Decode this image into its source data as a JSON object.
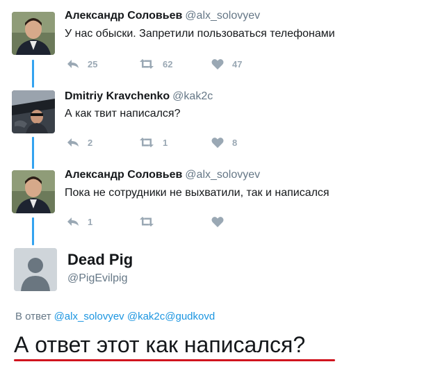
{
  "tweets": [
    {
      "name": "Александр Соловьев",
      "handle": "@alx_solovyev",
      "text": "У нас обыски. Запретили пользоваться телефонами",
      "reply_count": "25",
      "retweet_count": "62",
      "like_count": "47"
    },
    {
      "name": "Dmitriy Kravchenko",
      "handle": "@kak2c",
      "text": "А как твит написался?",
      "reply_count": "2",
      "retweet_count": "1",
      "like_count": "8"
    },
    {
      "name": "Александр Соловьев",
      "handle": "@alx_solovyev",
      "text": "Пока не сотрудники не выхватили, так и написался",
      "reply_count": "1",
      "retweet_count": "",
      "like_count": ""
    }
  ],
  "reply": {
    "name": "Dead Pig",
    "handle": "@PigEvilpig",
    "in_reply_label": "В ответ",
    "mentions": "@alx_solovyev @kak2c@gudkovd",
    "text": "А ответ этот как написался?"
  },
  "colors": {
    "thread_line": "#33a3f0",
    "mention": "#1b95e0",
    "underline": "#d0141e",
    "action_icon": "#9aa8b4"
  },
  "icons": [
    "reply-icon",
    "retweet-icon",
    "like-icon",
    "default-avatar-icon"
  ]
}
